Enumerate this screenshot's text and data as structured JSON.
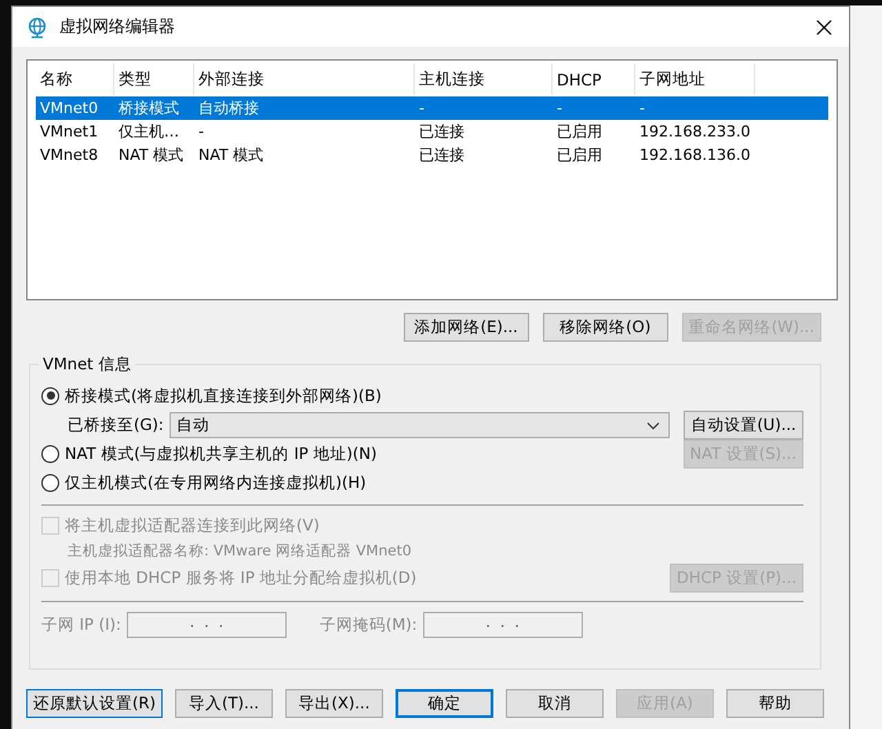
{
  "window": {
    "title": "虚拟网络编辑器"
  },
  "table": {
    "columns": [
      "名称",
      "类型",
      "外部连接",
      "主机连接",
      "DHCP",
      "子网地址"
    ],
    "rows": [
      {
        "cells": [
          "VMnet0",
          "桥接模式",
          "自动桥接",
          "-",
          "-",
          "-"
        ],
        "selected": true
      },
      {
        "cells": [
          "VMnet1",
          "仅主机…",
          "-",
          "已连接",
          "已启用",
          "192.168.233.0"
        ],
        "selected": false
      },
      {
        "cells": [
          "VMnet8",
          "NAT 模式",
          "NAT 模式",
          "已连接",
          "已启用",
          "192.168.136.0"
        ],
        "selected": false
      }
    ]
  },
  "table_buttons": [
    {
      "label": "添加网络(E)...",
      "disabled": false
    },
    {
      "label": "移除网络(O)",
      "disabled": false
    },
    {
      "label": "重命名网络(W)...",
      "disabled": true
    }
  ],
  "vmnet_info": {
    "legend": "VMnet 信息",
    "modes": [
      {
        "label": "桥接模式(将虚拟机直接连接到外部网络)(B)",
        "selected": true
      },
      {
        "label": "NAT 模式(与虚拟机共享主机的 IP 地址)(N)",
        "selected": false
      },
      {
        "label": "仅主机模式(在专用网络内连接虚拟机)(H)",
        "selected": false
      }
    ],
    "bridged_to": {
      "label": "已桥接至(G):",
      "value": "自动",
      "button": {
        "label": "自动设置(U)...",
        "disabled": false
      }
    },
    "nat_button": {
      "label": "NAT 设置(S)...",
      "disabled": true
    },
    "connect_adapter": {
      "label": "将主机虚拟适配器连接到此网络(V)",
      "checked": false,
      "disabled": true
    },
    "adapter_name": "主机虚拟适配器名称: VMware 网络适配器 VMnet0",
    "use_dhcp": {
      "label": "使用本地 DHCP 服务将 IP 地址分配给虚拟机(D)",
      "checked": false,
      "disabled": true
    },
    "dhcp_button": {
      "label": "DHCP 设置(P)...",
      "disabled": true
    },
    "subnet_ip": {
      "label": "子网 IP (I):",
      "value": " .  .  . "
    },
    "subnet_mask": {
      "label": "子网掩码(M):",
      "value": " .  .  . "
    }
  },
  "footer_buttons": [
    {
      "label": "还原默认设置(R)",
      "disabled": false,
      "default": false,
      "focused": true
    },
    {
      "label": "导入(T)...",
      "disabled": false,
      "default": false,
      "focused": false
    },
    {
      "label": "导出(X)...",
      "disabled": false,
      "default": false,
      "focused": false
    },
    {
      "label": "确定",
      "disabled": false,
      "default": true,
      "focused": false
    },
    {
      "label": "取消",
      "disabled": false,
      "default": false,
      "focused": false
    },
    {
      "label": "应用(A)",
      "disabled": true,
      "default": false,
      "focused": false
    },
    {
      "label": "帮助",
      "disabled": false,
      "default": false,
      "focused": false
    }
  ]
}
